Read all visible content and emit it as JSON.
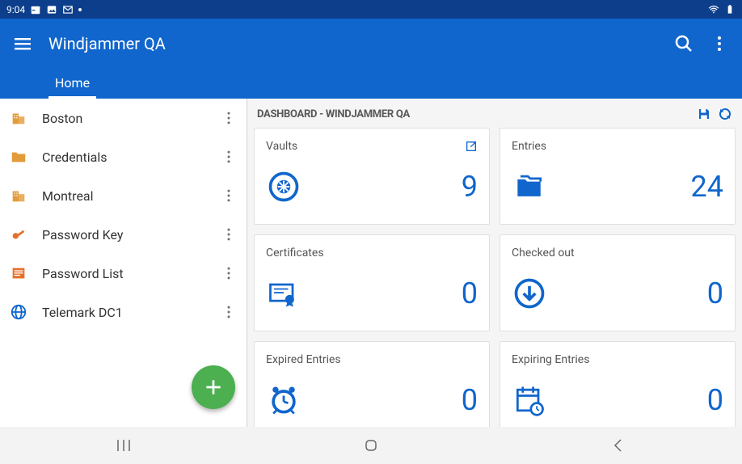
{
  "statusbar": {
    "time": "9:04"
  },
  "appbar": {
    "title": "Windjammer QA"
  },
  "tabs": [
    {
      "label": "Home",
      "active": true
    }
  ],
  "sidebar": {
    "items": [
      {
        "label": "Boston",
        "icon": "building",
        "color": "#e39b3a"
      },
      {
        "label": "Credentials",
        "icon": "folder",
        "color": "#e39b3a"
      },
      {
        "label": "Montreal",
        "icon": "building",
        "color": "#e39b3a"
      },
      {
        "label": "Password Key",
        "icon": "key",
        "color": "#e56f2a"
      },
      {
        "label": "Password List",
        "icon": "list",
        "color": "#e56f2a"
      },
      {
        "label": "Telemark DC1",
        "icon": "globe",
        "color": "#1066cc"
      }
    ]
  },
  "dashboard": {
    "title": "DASHBOARD - WINDJAMMER QA",
    "cards": [
      {
        "title": "Vaults",
        "value": "9",
        "icon": "vault",
        "open": true
      },
      {
        "title": "Entries",
        "value": "24",
        "icon": "folders",
        "open": false
      },
      {
        "title": "Certificates",
        "value": "0",
        "icon": "cert",
        "open": false
      },
      {
        "title": "Checked out",
        "value": "0",
        "icon": "download",
        "open": false
      },
      {
        "title": "Expired Entries",
        "value": "0",
        "icon": "clock",
        "open": false
      },
      {
        "title": "Expiring Entries",
        "value": "0",
        "icon": "calendar",
        "open": false
      }
    ]
  }
}
